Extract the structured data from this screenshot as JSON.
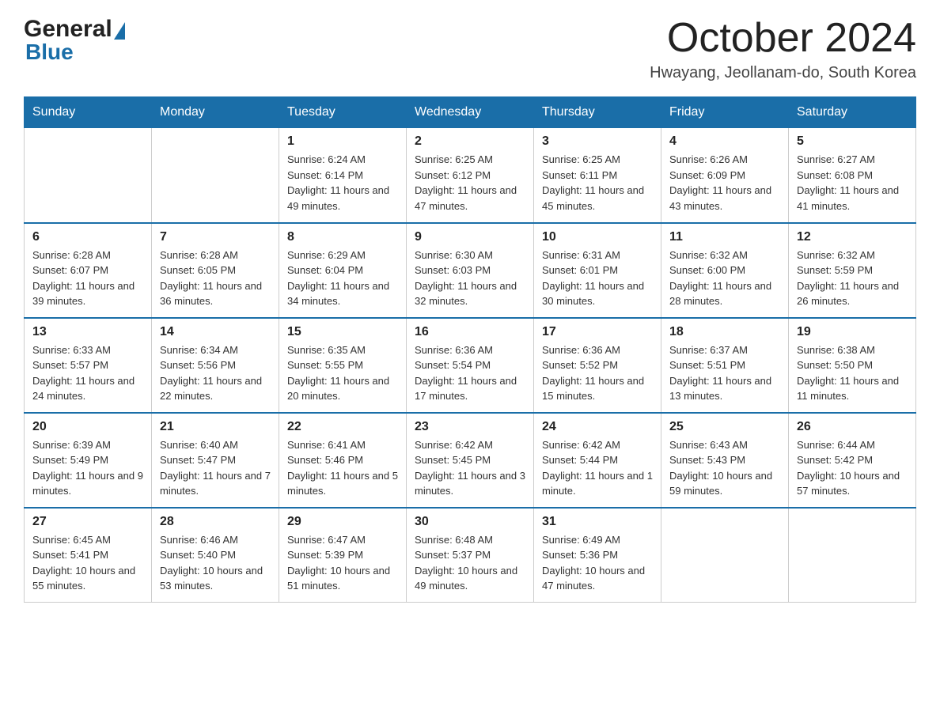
{
  "header": {
    "logo_general": "General",
    "logo_blue": "Blue",
    "month_year": "October 2024",
    "location": "Hwayang, Jeollanam-do, South Korea"
  },
  "days_of_week": [
    "Sunday",
    "Monday",
    "Tuesday",
    "Wednesday",
    "Thursday",
    "Friday",
    "Saturday"
  ],
  "weeks": [
    [
      {
        "day": "",
        "info": ""
      },
      {
        "day": "",
        "info": ""
      },
      {
        "day": "1",
        "info": "Sunrise: 6:24 AM\nSunset: 6:14 PM\nDaylight: 11 hours\nand 49 minutes."
      },
      {
        "day": "2",
        "info": "Sunrise: 6:25 AM\nSunset: 6:12 PM\nDaylight: 11 hours\nand 47 minutes."
      },
      {
        "day": "3",
        "info": "Sunrise: 6:25 AM\nSunset: 6:11 PM\nDaylight: 11 hours\nand 45 minutes."
      },
      {
        "day": "4",
        "info": "Sunrise: 6:26 AM\nSunset: 6:09 PM\nDaylight: 11 hours\nand 43 minutes."
      },
      {
        "day": "5",
        "info": "Sunrise: 6:27 AM\nSunset: 6:08 PM\nDaylight: 11 hours\nand 41 minutes."
      }
    ],
    [
      {
        "day": "6",
        "info": "Sunrise: 6:28 AM\nSunset: 6:07 PM\nDaylight: 11 hours\nand 39 minutes."
      },
      {
        "day": "7",
        "info": "Sunrise: 6:28 AM\nSunset: 6:05 PM\nDaylight: 11 hours\nand 36 minutes."
      },
      {
        "day": "8",
        "info": "Sunrise: 6:29 AM\nSunset: 6:04 PM\nDaylight: 11 hours\nand 34 minutes."
      },
      {
        "day": "9",
        "info": "Sunrise: 6:30 AM\nSunset: 6:03 PM\nDaylight: 11 hours\nand 32 minutes."
      },
      {
        "day": "10",
        "info": "Sunrise: 6:31 AM\nSunset: 6:01 PM\nDaylight: 11 hours\nand 30 minutes."
      },
      {
        "day": "11",
        "info": "Sunrise: 6:32 AM\nSunset: 6:00 PM\nDaylight: 11 hours\nand 28 minutes."
      },
      {
        "day": "12",
        "info": "Sunrise: 6:32 AM\nSunset: 5:59 PM\nDaylight: 11 hours\nand 26 minutes."
      }
    ],
    [
      {
        "day": "13",
        "info": "Sunrise: 6:33 AM\nSunset: 5:57 PM\nDaylight: 11 hours\nand 24 minutes."
      },
      {
        "day": "14",
        "info": "Sunrise: 6:34 AM\nSunset: 5:56 PM\nDaylight: 11 hours\nand 22 minutes."
      },
      {
        "day": "15",
        "info": "Sunrise: 6:35 AM\nSunset: 5:55 PM\nDaylight: 11 hours\nand 20 minutes."
      },
      {
        "day": "16",
        "info": "Sunrise: 6:36 AM\nSunset: 5:54 PM\nDaylight: 11 hours\nand 17 minutes."
      },
      {
        "day": "17",
        "info": "Sunrise: 6:36 AM\nSunset: 5:52 PM\nDaylight: 11 hours\nand 15 minutes."
      },
      {
        "day": "18",
        "info": "Sunrise: 6:37 AM\nSunset: 5:51 PM\nDaylight: 11 hours\nand 13 minutes."
      },
      {
        "day": "19",
        "info": "Sunrise: 6:38 AM\nSunset: 5:50 PM\nDaylight: 11 hours\nand 11 minutes."
      }
    ],
    [
      {
        "day": "20",
        "info": "Sunrise: 6:39 AM\nSunset: 5:49 PM\nDaylight: 11 hours\nand 9 minutes."
      },
      {
        "day": "21",
        "info": "Sunrise: 6:40 AM\nSunset: 5:47 PM\nDaylight: 11 hours\nand 7 minutes."
      },
      {
        "day": "22",
        "info": "Sunrise: 6:41 AM\nSunset: 5:46 PM\nDaylight: 11 hours\nand 5 minutes."
      },
      {
        "day": "23",
        "info": "Sunrise: 6:42 AM\nSunset: 5:45 PM\nDaylight: 11 hours\nand 3 minutes."
      },
      {
        "day": "24",
        "info": "Sunrise: 6:42 AM\nSunset: 5:44 PM\nDaylight: 11 hours\nand 1 minute."
      },
      {
        "day": "25",
        "info": "Sunrise: 6:43 AM\nSunset: 5:43 PM\nDaylight: 10 hours\nand 59 minutes."
      },
      {
        "day": "26",
        "info": "Sunrise: 6:44 AM\nSunset: 5:42 PM\nDaylight: 10 hours\nand 57 minutes."
      }
    ],
    [
      {
        "day": "27",
        "info": "Sunrise: 6:45 AM\nSunset: 5:41 PM\nDaylight: 10 hours\nand 55 minutes."
      },
      {
        "day": "28",
        "info": "Sunrise: 6:46 AM\nSunset: 5:40 PM\nDaylight: 10 hours\nand 53 minutes."
      },
      {
        "day": "29",
        "info": "Sunrise: 6:47 AM\nSunset: 5:39 PM\nDaylight: 10 hours\nand 51 minutes."
      },
      {
        "day": "30",
        "info": "Sunrise: 6:48 AM\nSunset: 5:37 PM\nDaylight: 10 hours\nand 49 minutes."
      },
      {
        "day": "31",
        "info": "Sunrise: 6:49 AM\nSunset: 5:36 PM\nDaylight: 10 hours\nand 47 minutes."
      },
      {
        "day": "",
        "info": ""
      },
      {
        "day": "",
        "info": ""
      }
    ]
  ],
  "colors": {
    "header_bg": "#1a6ea8",
    "border": "#bbb",
    "row_border": "#1a6ea8"
  }
}
